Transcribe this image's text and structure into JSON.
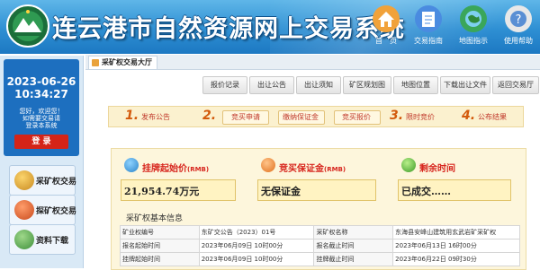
{
  "header": {
    "title": "连云港市自然资源网上交易系统",
    "nav": [
      {
        "label": "首　页",
        "icon": "home-icon"
      },
      {
        "label": "交易指南",
        "icon": "guide-icon"
      },
      {
        "label": "地图指示",
        "icon": "globe-icon"
      },
      {
        "label": "使用帮助",
        "icon": "help-icon"
      }
    ]
  },
  "sidebar": {
    "date": "2023-06-26",
    "time": "10:34:27",
    "greeting": "您好，欢迎您！",
    "notice_line1": "如需要交易请",
    "notice_line2": "登录本系统",
    "login_label": "登  录",
    "items": [
      {
        "label": "采矿权交易",
        "icon": "mining-right-icon"
      },
      {
        "label": "探矿权交易",
        "icon": "exploration-right-icon"
      },
      {
        "label": "资料下载",
        "icon": "download-icon"
      }
    ]
  },
  "tab": {
    "label": "采矿权交易大厅"
  },
  "subnav": [
    "报价记录",
    "出让公告",
    "出让须知",
    "矿区规划图",
    "地图位置",
    "下载出让文件",
    "返回交易厅"
  ],
  "steps": [
    {
      "num": "1.",
      "label": "发布公告"
    },
    {
      "num": "2.",
      "label": "竞买申请"
    },
    {
      "label": "缴纳保证金"
    },
    {
      "label": "竞买报价"
    },
    {
      "num": "3.",
      "label": "限时竞价"
    },
    {
      "num": "4.",
      "label": "公布结果"
    }
  ],
  "info": {
    "start_price_label": "挂牌起始价",
    "start_price_unit": "(RMB)",
    "start_price_value": "21,954.74万元",
    "deposit_label": "竞买保证金",
    "deposit_unit": "(RMB)",
    "deposit_value": "无保证金",
    "remaining_label": "剩余时间",
    "remaining_value": "已成交……"
  },
  "basic": {
    "title": "采矿权基本信息",
    "rows": [
      [
        "矿业权编号",
        "东矿交公告（2023）01号",
        "采矿权名称",
        "东海县安峰山建筑用玄武岩矿采矿权"
      ],
      [
        "报名起始时间",
        "2023年06月09日 10时00分",
        "报名截止时间",
        "2023年06月13日 16时00分"
      ],
      [
        "挂牌起始时间",
        "2023年06月09日 10时00分",
        "挂牌截止时间",
        "2023年06月22日 09时30分"
      ]
    ]
  },
  "colors": {
    "header_blue": "#2e8fd3",
    "sidebar_clock_bg": "#1d6fbf",
    "login_red": "#d42418",
    "label_red": "#d7261e",
    "step_orange": "#d35a0c",
    "panel_cream": "#fdf6dc"
  }
}
